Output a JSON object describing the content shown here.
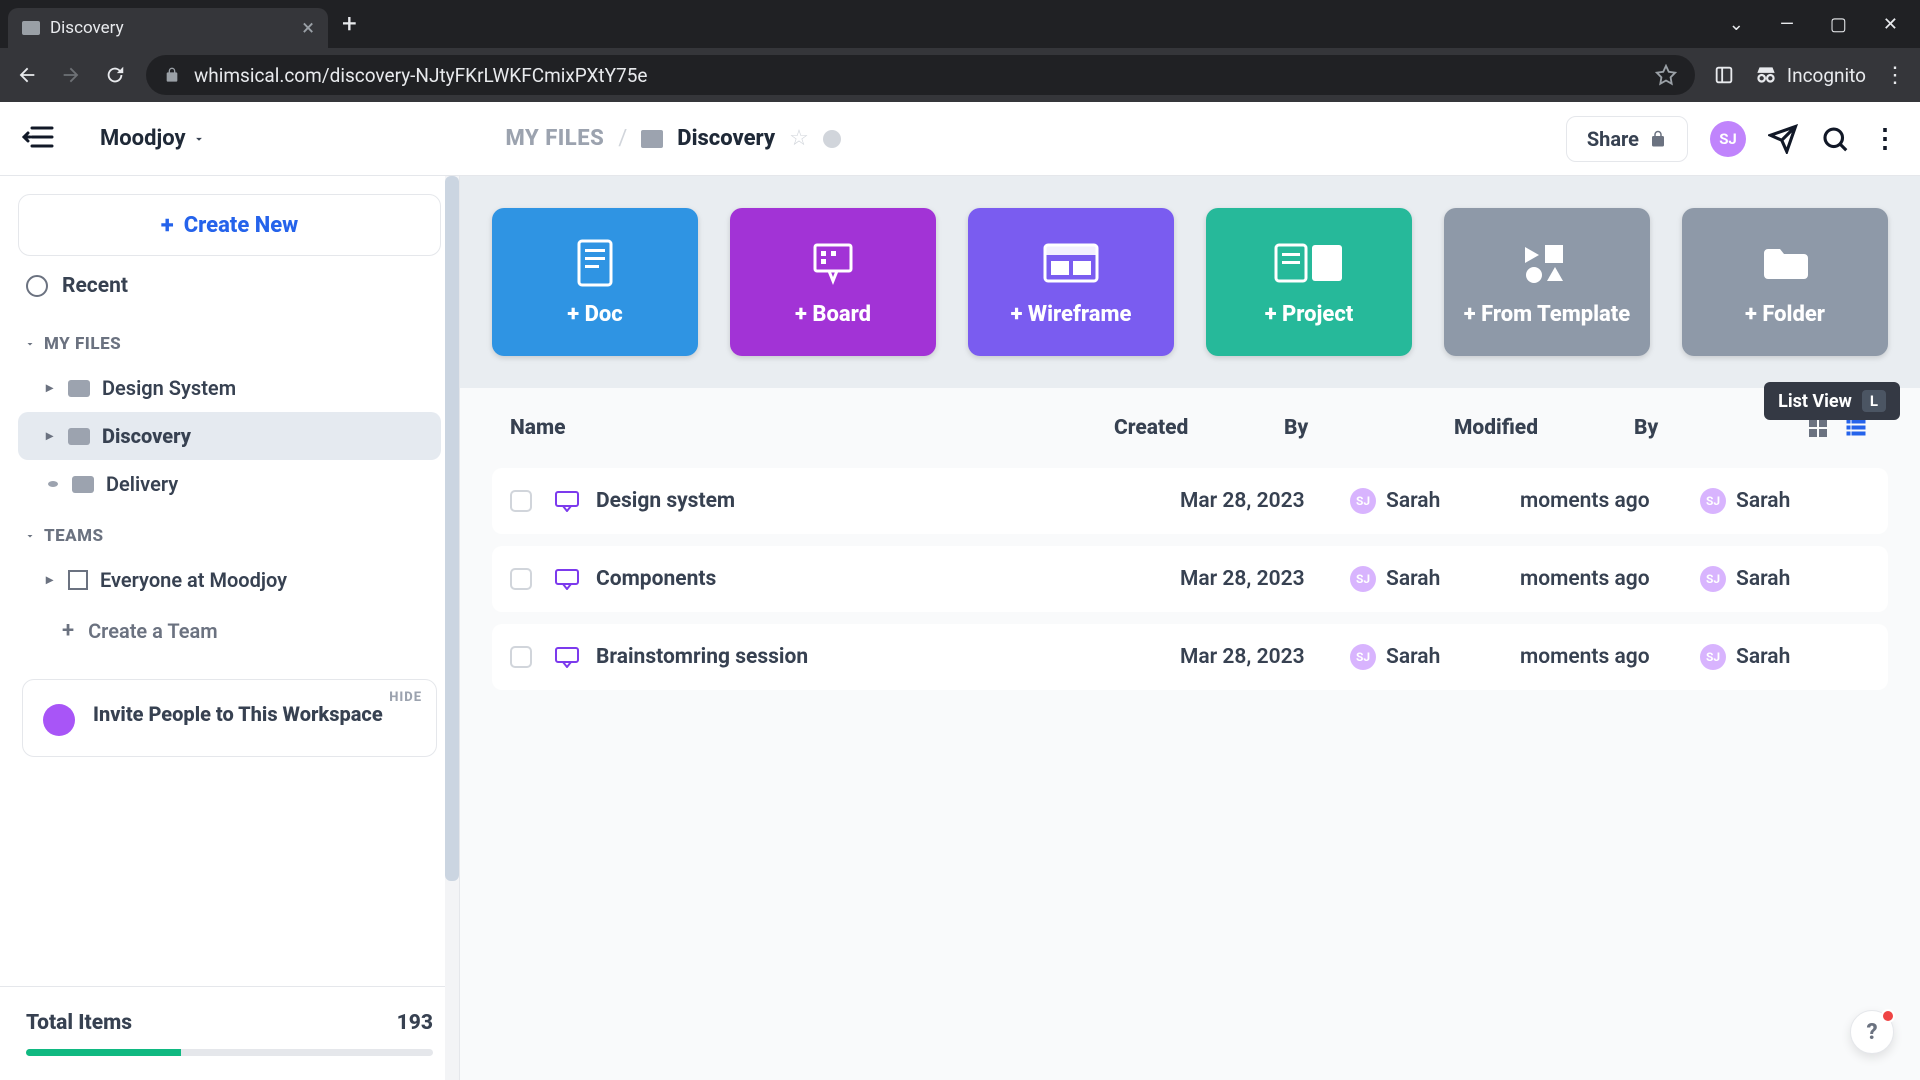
{
  "browser": {
    "tab_title": "Discovery",
    "url": "whimsical.com/discovery-NJtyFKrLWKFCmixPXtY75e",
    "mode": "Incognito"
  },
  "header": {
    "workspace": "Moodjoy",
    "breadcrumb_root": "MY FILES",
    "breadcrumb_current": "Discovery",
    "share": "Share",
    "avatar_initials": "SJ"
  },
  "sidebar": {
    "create_new": "Create New",
    "recent": "Recent",
    "my_files_label": "MY FILES",
    "files": [
      {
        "name": "Design System",
        "active": false,
        "caret": true
      },
      {
        "name": "Discovery",
        "active": true,
        "caret": true
      },
      {
        "name": "Delivery",
        "active": false,
        "caret": false
      }
    ],
    "teams_label": "TEAMS",
    "teams": [
      {
        "name": "Everyone at Moodjoy"
      }
    ],
    "create_team": "Create a Team",
    "invite_hide": "HIDE",
    "invite_text": "Invite People to This Workspace",
    "totals_label": "Total Items",
    "totals_count": "193",
    "totals_pct": 38
  },
  "create_cards": [
    {
      "label": "+ Doc",
      "kind": "doc"
    },
    {
      "label": "+ Board",
      "kind": "board"
    },
    {
      "label": "+ Wireframe",
      "kind": "wire"
    },
    {
      "label": "+ Project",
      "kind": "proj"
    },
    {
      "label": "+ From Template",
      "kind": "tmpl"
    },
    {
      "label": "+ Folder",
      "kind": "folder"
    }
  ],
  "list": {
    "columns": {
      "name": "Name",
      "created": "Created",
      "by1": "By",
      "modified": "Modified",
      "by2": "By"
    },
    "tooltip_label": "List View",
    "tooltip_key": "L",
    "rows": [
      {
        "name": "Design system",
        "created": "Mar 28, 2023",
        "created_by": "Sarah",
        "modified": "moments ago",
        "modified_by": "Sarah",
        "avatar": "SJ"
      },
      {
        "name": "Components",
        "created": "Mar 28, 2023",
        "created_by": "Sarah",
        "modified": "moments ago",
        "modified_by": "Sarah",
        "avatar": "SJ"
      },
      {
        "name": "Brainstomring session",
        "created": "Mar 28, 2023",
        "created_by": "Sarah",
        "modified": "moments ago",
        "modified_by": "Sarah",
        "avatar": "SJ"
      }
    ]
  }
}
